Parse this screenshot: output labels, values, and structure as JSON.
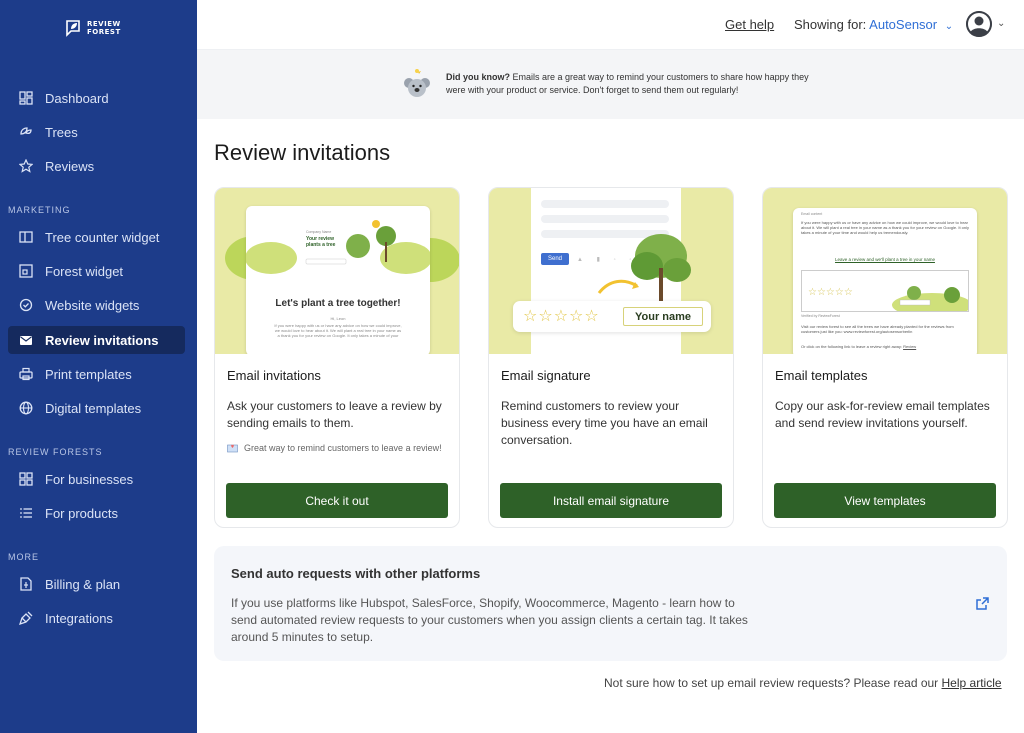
{
  "brand": {
    "logo_line1": "REVIEW",
    "logo_line2": "FOREST",
    "color": "#1d3c8a"
  },
  "sidebar": {
    "items_main": [
      {
        "label": "Dashboard",
        "icon": "dashboard-icon"
      },
      {
        "label": "Trees",
        "icon": "sprout-icon"
      },
      {
        "label": "Reviews",
        "icon": "star-icon"
      }
    ],
    "section_marketing": "MARKETING",
    "items_marketing": [
      {
        "label": "Tree counter widget",
        "icon": "panel-icon"
      },
      {
        "label": "Forest widget",
        "icon": "widget-icon"
      },
      {
        "label": "Website widgets",
        "icon": "badge-check-icon"
      },
      {
        "label": "Review invitations",
        "icon": "mail-icon",
        "active": true
      },
      {
        "label": "Print templates",
        "icon": "printer-icon"
      },
      {
        "label": "Digital templates",
        "icon": "globe-icon"
      }
    ],
    "section_forests": "REVIEW FORESTS",
    "items_forests": [
      {
        "label": "For businesses",
        "icon": "grid-icon"
      },
      {
        "label": "For products",
        "icon": "list-icon"
      }
    ],
    "section_more": "MORE",
    "items_more": [
      {
        "label": "Billing & plan",
        "icon": "dollar-doc-icon"
      },
      {
        "label": "Integrations",
        "icon": "plug-icon"
      }
    ]
  },
  "topbar": {
    "get_help": "Get help",
    "showing_label": "Showing for:",
    "account": "AutoSensor"
  },
  "banner": {
    "bold": "Did you know?",
    "text": " Emails are a great way to remind your customers to share how happy they were with your product or service. Don't forget to send them out regularly!"
  },
  "page": {
    "title": "Review invitations"
  },
  "cards": [
    {
      "title": "Email invitations",
      "desc": "Ask your customers to leave a review by sending emails to them.",
      "note": "Great way to remind customers to leave a review!",
      "button": "Check it out",
      "illus": {
        "company": "Company Name",
        "headline": "Your review plants a tree",
        "big": "Let's plant a tree together!",
        "greeting": "Hi, Leon",
        "body": "If you were happy with us or have any advice on how we could improve, we would love to hear about it. We will plant a real tree in your name as a thank you for your review on Google. It only takes a minute of your"
      }
    },
    {
      "title": "Email signature",
      "desc": "Remind customers to review your business every time you have an email conversation.",
      "button": "Install email signature",
      "illus": {
        "send": "Send",
        "your_name": "Your name"
      }
    },
    {
      "title": "Email templates",
      "desc": "Copy our ask-for-review email templates and send review invitations yourself.",
      "button": "View templates",
      "illus": {
        "label": "Email content",
        "body": "If you were happy with us or have any advice on how we could improve, we would love to hear about it. We will plant a real tree in your name as a thank you for your review on Google. It only takes a minute of your time and would help us tremendously.",
        "link": "Leave a review and we'll plant a tree in your name",
        "visit": "Visit our review forest to see all the trees we have already planted for the reviews from customers just like you: www.reviewforest.org/autosensorberlin",
        "click": "Or click on the following link to leave a review right away:",
        "review": "Review",
        "verified": "Verified by ReviewForest"
      }
    }
  ],
  "auto_requests": {
    "title": "Send auto requests with other platforms",
    "desc": "If you use platforms like Hubspot, SalesForce, Shopify, Woocommerce, Magento - learn how to send automated review requests to your customers when you assign clients a certain tag. It takes around 5 minutes to setup."
  },
  "footer": {
    "text": "Not sure how to set up email review requests? Please read our",
    "link": "Help article"
  },
  "colors": {
    "button": "#2e6128",
    "illus_bg": "#e9eaa6",
    "accent": "#2f6fd6"
  }
}
